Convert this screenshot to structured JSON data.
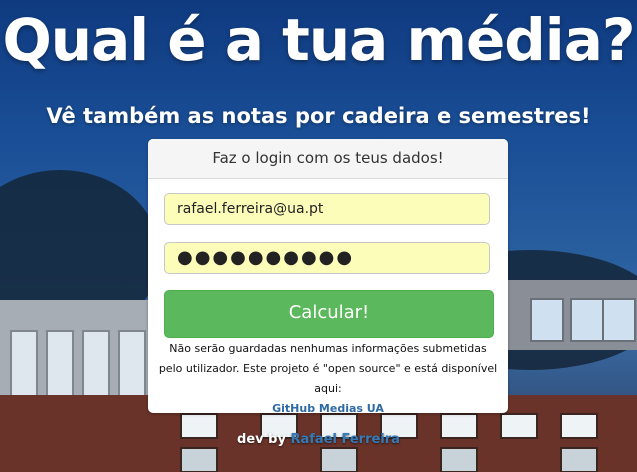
{
  "hero": {
    "title": "Qual é a tua média?",
    "subtitle": "Vê também as notas por cadeira e semestres!"
  },
  "login": {
    "heading": "Faz o login com os teus dados!",
    "email_value": "rafael.ferreira@ua.pt",
    "password_mask": "●●●●●●●●●●",
    "submit_label": "Calcular!",
    "note_text": "Não serão guardadas nenhumas informações submetidas pelo utilizador. Este projeto é \"open source\" e está disponível aqui:",
    "github_link": "GitHub Medias UA"
  },
  "footer": {
    "prefix": "dev by",
    "author": "Rafael Ferreira"
  },
  "colors": {
    "submit": "#5cb85c",
    "input_bg": "#fbfdb9",
    "link": "#2d6aa6"
  }
}
